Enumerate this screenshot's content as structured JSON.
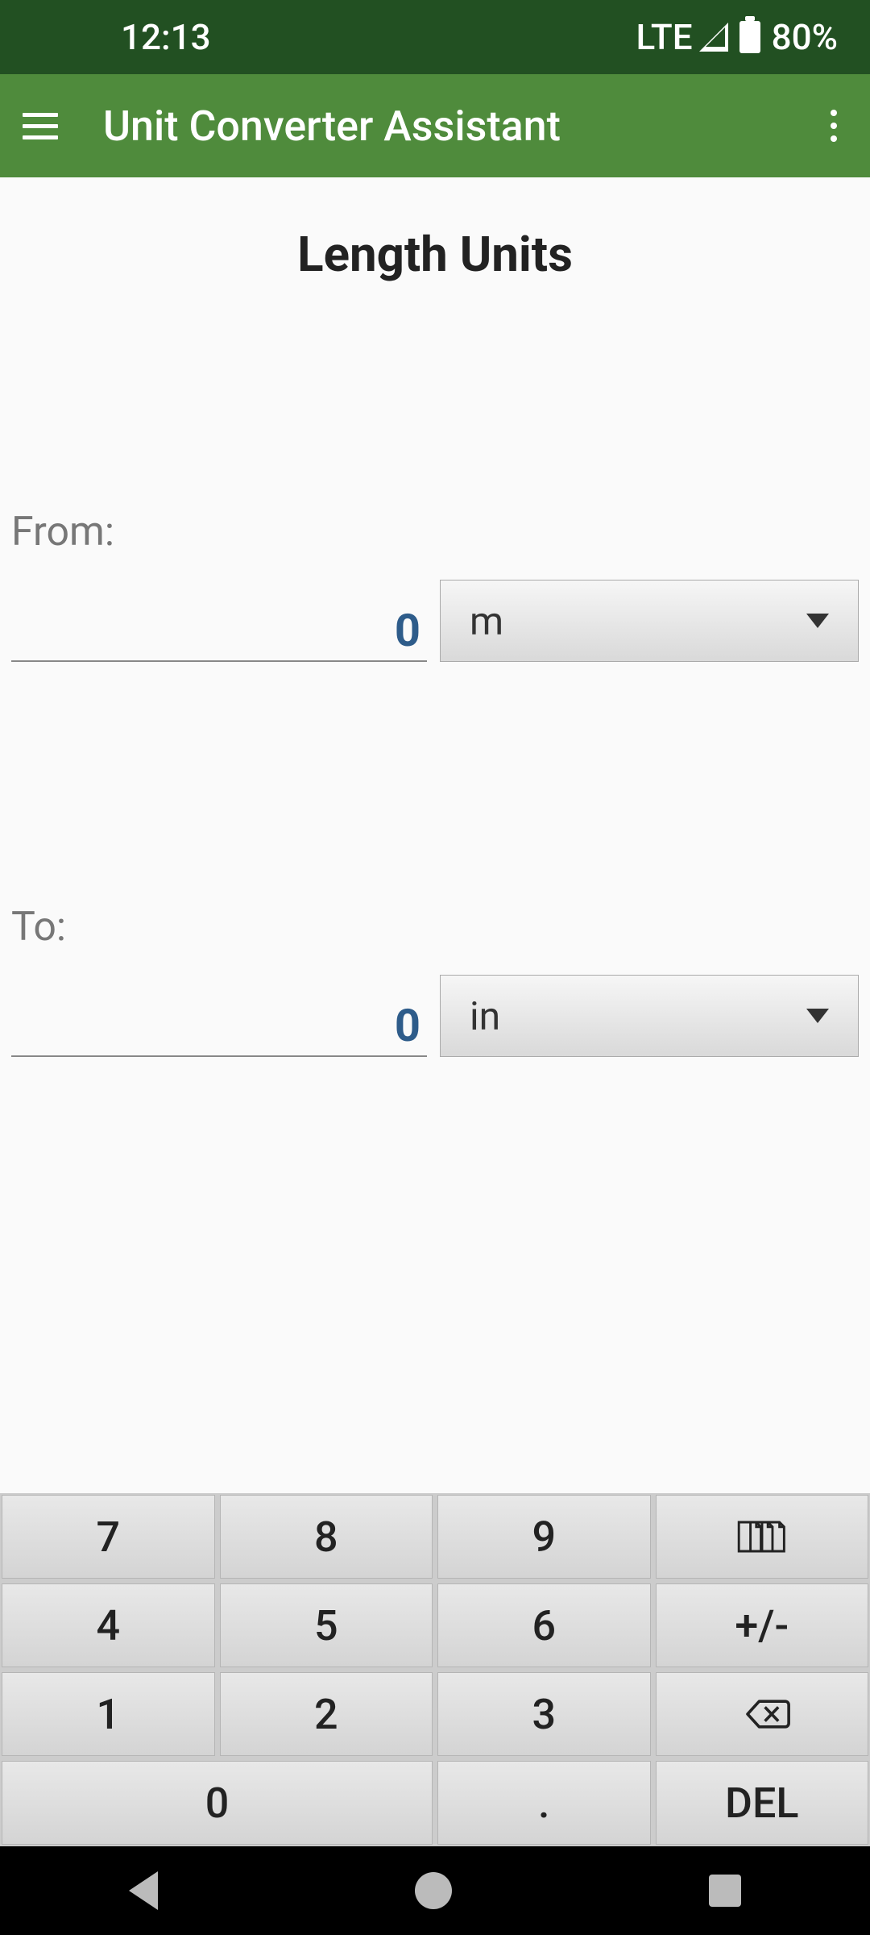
{
  "status": {
    "time": "12:13",
    "network": "LTE",
    "battery": "80%"
  },
  "appbar": {
    "title": "Unit Converter Assistant"
  },
  "page": {
    "title": "Length Units"
  },
  "from": {
    "label": "From:",
    "value": "0",
    "unit": "m"
  },
  "to": {
    "label": "To:",
    "value": "0",
    "unit": "in"
  },
  "keys": {
    "k7": "7",
    "k8": "8",
    "k9": "9",
    "k4": "4",
    "k5": "5",
    "k6": "6",
    "pm": "+/-",
    "k1": "1",
    "k2": "2",
    "k3": "3",
    "k0": "0",
    "dot": ".",
    "del": "DEL"
  }
}
